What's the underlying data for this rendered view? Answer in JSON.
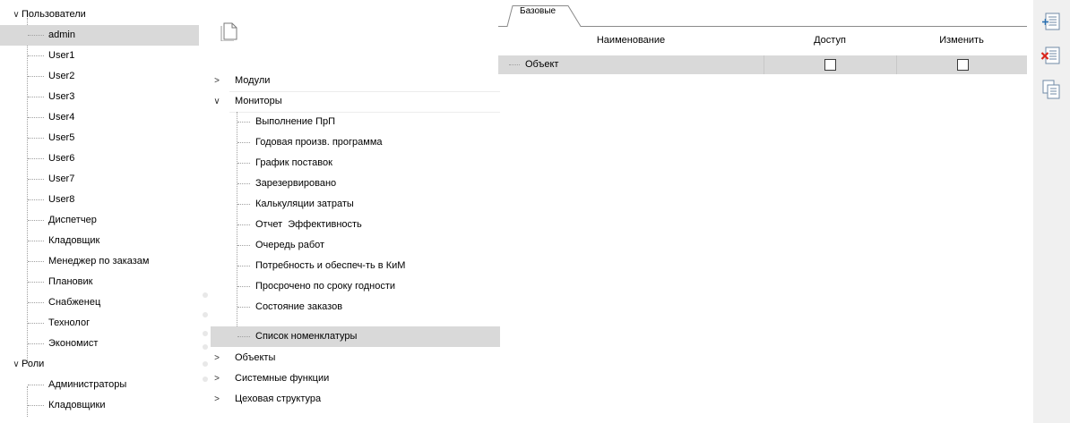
{
  "users_tree": {
    "users_group": "Пользователи",
    "users": [
      "admin",
      "User1",
      "User2",
      "User3",
      "User4",
      "User5",
      "User6",
      "User7",
      "User8",
      "Диспетчер",
      "Кладовщик",
      "Менеджер по заказам",
      "Плановик",
      "Снабженец",
      "Технолог",
      "Экономист"
    ],
    "roles_group": "Роли",
    "roles": [
      "Администраторы",
      "Кладовщики"
    ]
  },
  "modules_tree": {
    "modules": "Модули",
    "monitors": "Мониторы",
    "monitor_items": [
      "Выполнение ПрП",
      "Годовая произв. программа",
      "График поставок",
      "Зарезервировано",
      "Калькуляции затраты",
      "Отчет  Эффективность",
      "Очередь работ",
      "Потребность и обеспеч-ть в КиМ",
      "Просрочено по сроку годности",
      "Состояние заказов",
      "Список номенклатуры"
    ],
    "objects": "Объекты",
    "system_functions": "Системные функции",
    "shop_structure": "Цеховая структура"
  },
  "rights_grid": {
    "tab_label": "Базовые",
    "columns": [
      "Наименование",
      "Доступ",
      "Изменить"
    ],
    "rows": [
      {
        "name": "Объект",
        "access": false,
        "edit": false
      }
    ]
  }
}
